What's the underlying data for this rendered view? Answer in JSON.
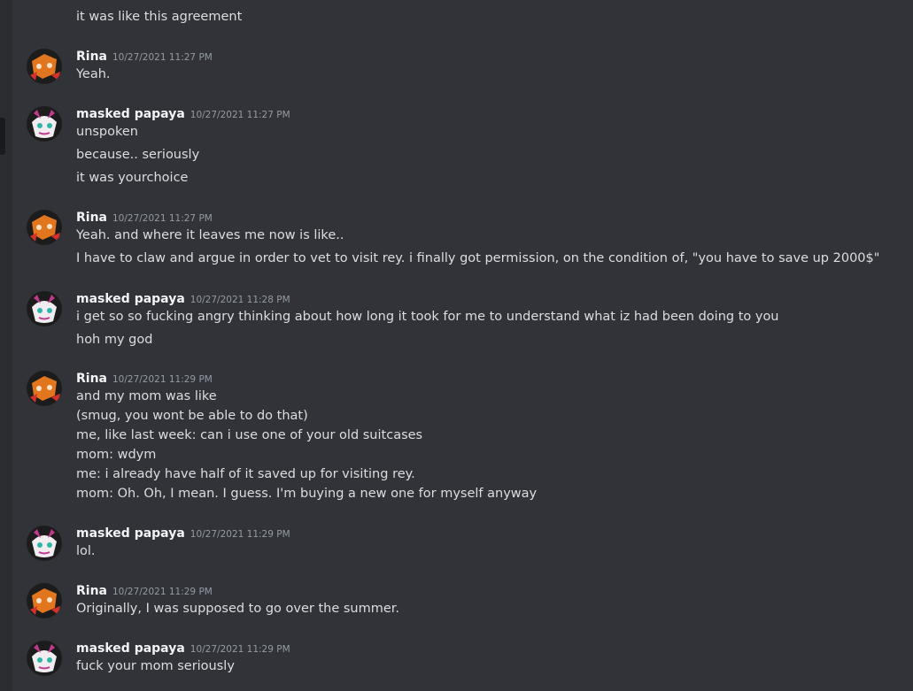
{
  "top": {
    "partial_line": "it was like this agreement"
  },
  "messages": [
    {
      "author": "Rina",
      "avatar": "rina-avatar",
      "timestamp": "10/27/2021 11:27 PM",
      "lines": [
        "Yeah."
      ]
    },
    {
      "author": "masked papaya",
      "avatar": "papaya-avatar",
      "timestamp": "10/27/2021 11:27 PM",
      "lines": [
        "unspoken",
        "because.. seriously",
        "it was yourchoice"
      ]
    },
    {
      "author": "Rina",
      "avatar": "rina-avatar",
      "timestamp": "10/27/2021 11:27 PM",
      "lines": [
        "Yeah. and where it leaves me now is like..",
        "I have to claw and argue in order to vet to visit rey. i finally got permission, on the condition of, \"you have to save up 2000$\""
      ]
    },
    {
      "author": "masked papaya",
      "avatar": "papaya-avatar",
      "timestamp": "10/27/2021 11:28 PM",
      "lines": [
        "i get so so fucking angry thinking about how long it took for me to understand what iz had been doing to you",
        "hoh my god"
      ]
    },
    {
      "author": "Rina",
      "avatar": "rina-avatar",
      "timestamp": "10/27/2021 11:29 PM",
      "lines": [
        "and my mom was like",
        "(smug, you wont be able to do that)",
        "me, like last week: can i use one of your old suitcases",
        "mom: wdym",
        "me: i already have half of it saved up for visiting rey.",
        "mom: Oh. Oh, I mean. I guess. I'm buying a new one for myself anyway"
      ]
    },
    {
      "author": "masked papaya",
      "avatar": "papaya-avatar",
      "timestamp": "10/27/2021 11:29 PM",
      "lines": [
        "lol."
      ]
    },
    {
      "author": "Rina",
      "avatar": "rina-avatar",
      "timestamp": "10/27/2021 11:29 PM",
      "lines": [
        "Originally, I was supposed to go over the summer."
      ]
    },
    {
      "author": "masked papaya",
      "avatar": "papaya-avatar",
      "timestamp": "10/27/2021 11:29 PM",
      "lines": [
        "fuck your mom seriously"
      ]
    }
  ]
}
